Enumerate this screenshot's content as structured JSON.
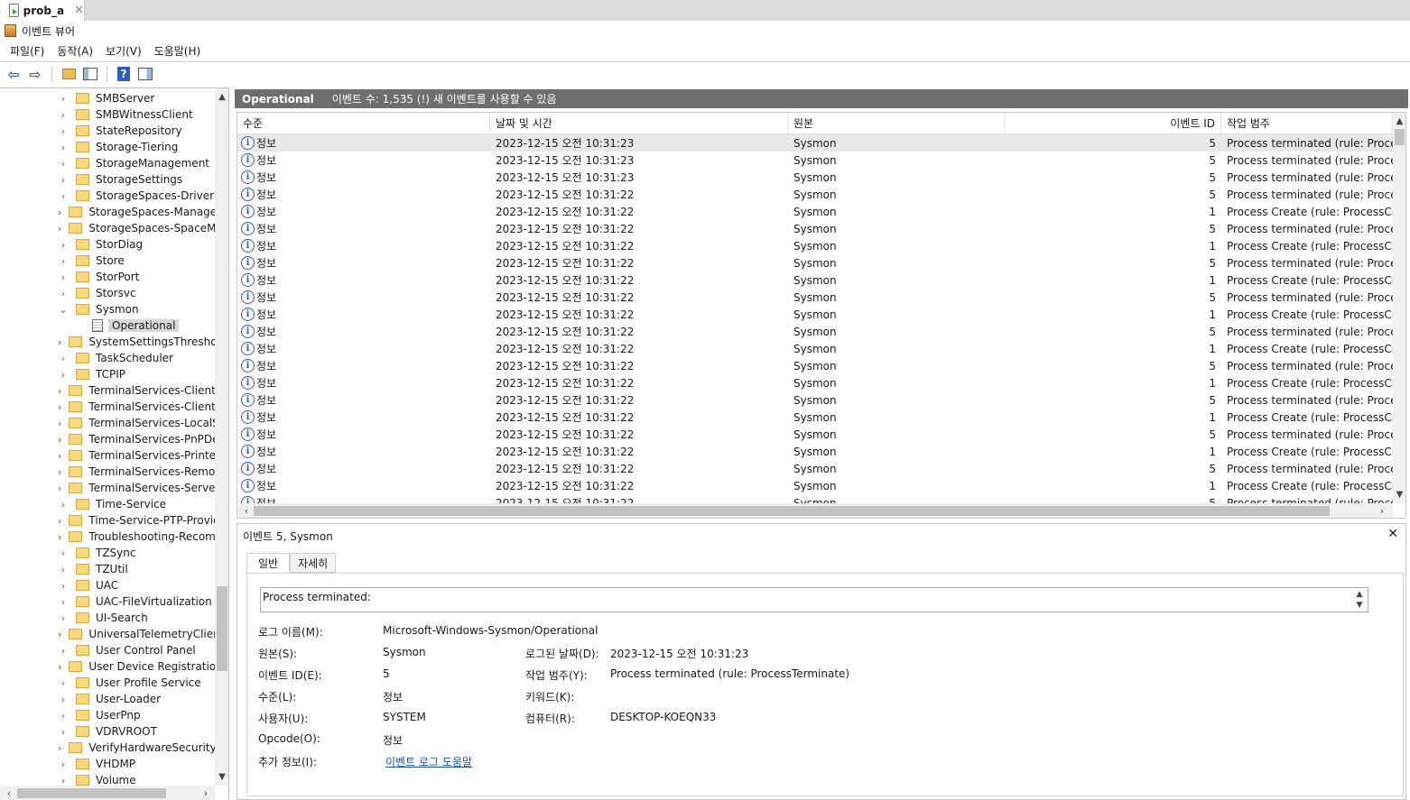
{
  "tab": {
    "title": "prob_a",
    "close": "✕"
  },
  "app": {
    "title": "이벤트 뷰어"
  },
  "menu": [
    "파일(F)",
    "동작(A)",
    "보기(V)",
    "도움말(H)"
  ],
  "tree": {
    "items": [
      {
        "label": "SMBServer",
        "expanded": false
      },
      {
        "label": "SMBWitnessClient",
        "expanded": false
      },
      {
        "label": "StateRepository",
        "expanded": false
      },
      {
        "label": "Storage-Tiering",
        "expanded": false
      },
      {
        "label": "StorageManagement",
        "expanded": false
      },
      {
        "label": "StorageSettings",
        "expanded": false
      },
      {
        "label": "StorageSpaces-Driver",
        "expanded": false
      },
      {
        "label": "StorageSpaces-Managem",
        "expanded": false
      },
      {
        "label": "StorageSpaces-SpaceMai",
        "expanded": false
      },
      {
        "label": "StorDiag",
        "expanded": false
      },
      {
        "label": "Store",
        "expanded": false
      },
      {
        "label": "StorPort",
        "expanded": false
      },
      {
        "label": "Storsvc",
        "expanded": false
      },
      {
        "label": "Sysmon",
        "expanded": true
      },
      {
        "label": "Operational",
        "log": true,
        "selected": true
      },
      {
        "label": "SystemSettingsThreshold",
        "expanded": false
      },
      {
        "label": "TaskScheduler",
        "expanded": false
      },
      {
        "label": "TCPIP",
        "expanded": false
      },
      {
        "label": "TerminalServices-ClientA",
        "expanded": false
      },
      {
        "label": "TerminalServices-ClientU",
        "expanded": false
      },
      {
        "label": "TerminalServices-LocalSe",
        "expanded": false
      },
      {
        "label": "TerminalServices-PnPDev",
        "expanded": false
      },
      {
        "label": "TerminalServices-Printers",
        "expanded": false
      },
      {
        "label": "TerminalServices-Remote",
        "expanded": false
      },
      {
        "label": "TerminalServices-ServerU",
        "expanded": false
      },
      {
        "label": "Time-Service",
        "expanded": false
      },
      {
        "label": "Time-Service-PTP-Provid",
        "expanded": false
      },
      {
        "label": "Troubleshooting-Recomm",
        "expanded": false
      },
      {
        "label": "TZSync",
        "expanded": false
      },
      {
        "label": "TZUtil",
        "expanded": false
      },
      {
        "label": "UAC",
        "expanded": false
      },
      {
        "label": "UAC-FileVirtualization",
        "expanded": false
      },
      {
        "label": "UI-Search",
        "expanded": false
      },
      {
        "label": "UniversalTelemetryClient",
        "expanded": false
      },
      {
        "label": "User Control Panel",
        "expanded": false
      },
      {
        "label": "User Device Registration",
        "expanded": false
      },
      {
        "label": "User Profile Service",
        "expanded": false
      },
      {
        "label": "User-Loader",
        "expanded": false
      },
      {
        "label": "UserPnp",
        "expanded": false
      },
      {
        "label": "VDRVROOT",
        "expanded": false
      },
      {
        "label": "VerifyHardwareSecurity",
        "expanded": false
      },
      {
        "label": "VHDMP",
        "expanded": false
      },
      {
        "label": "Volume",
        "expanded": false
      }
    ]
  },
  "header": {
    "title": "Operational",
    "count": "이벤트 수: 1,535 (!) 새 이벤트를 사용할 수 있음"
  },
  "columns": [
    "수준",
    "날짜 및 시간",
    "원본",
    "이벤트 ID",
    "작업 범주"
  ],
  "events": [
    {
      "level": "정보",
      "date": "2023-12-15 오전 10:31:23",
      "source": "Sysmon",
      "id": "5",
      "category": "Process terminated (rule: ProcessT"
    },
    {
      "level": "정보",
      "date": "2023-12-15 오전 10:31:23",
      "source": "Sysmon",
      "id": "5",
      "category": "Process terminated (rule: ProcessT"
    },
    {
      "level": "정보",
      "date": "2023-12-15 오전 10:31:23",
      "source": "Sysmon",
      "id": "5",
      "category": "Process terminated (rule: ProcessT"
    },
    {
      "level": "정보",
      "date": "2023-12-15 오전 10:31:22",
      "source": "Sysmon",
      "id": "5",
      "category": "Process terminated (rule: ProcessT"
    },
    {
      "level": "정보",
      "date": "2023-12-15 오전 10:31:22",
      "source": "Sysmon",
      "id": "1",
      "category": "Process Create (rule: ProcessCreat"
    },
    {
      "level": "정보",
      "date": "2023-12-15 오전 10:31:22",
      "source": "Sysmon",
      "id": "5",
      "category": "Process terminated (rule: ProcessT"
    },
    {
      "level": "정보",
      "date": "2023-12-15 오전 10:31:22",
      "source": "Sysmon",
      "id": "1",
      "category": "Process Create (rule: ProcessCreat"
    },
    {
      "level": "정보",
      "date": "2023-12-15 오전 10:31:22",
      "source": "Sysmon",
      "id": "5",
      "category": "Process terminated (rule: ProcessT"
    },
    {
      "level": "정보",
      "date": "2023-12-15 오전 10:31:22",
      "source": "Sysmon",
      "id": "1",
      "category": "Process Create (rule: ProcessCreat"
    },
    {
      "level": "정보",
      "date": "2023-12-15 오전 10:31:22",
      "source": "Sysmon",
      "id": "5",
      "category": "Process terminated (rule: ProcessT"
    },
    {
      "level": "정보",
      "date": "2023-12-15 오전 10:31:22",
      "source": "Sysmon",
      "id": "1",
      "category": "Process Create (rule: ProcessCreat"
    },
    {
      "level": "정보",
      "date": "2023-12-15 오전 10:31:22",
      "source": "Sysmon",
      "id": "5",
      "category": "Process terminated (rule: ProcessT"
    },
    {
      "level": "정보",
      "date": "2023-12-15 오전 10:31:22",
      "source": "Sysmon",
      "id": "1",
      "category": "Process Create (rule: ProcessCreat"
    },
    {
      "level": "정보",
      "date": "2023-12-15 오전 10:31:22",
      "source": "Sysmon",
      "id": "5",
      "category": "Process terminated (rule: ProcessT"
    },
    {
      "level": "정보",
      "date": "2023-12-15 오전 10:31:22",
      "source": "Sysmon",
      "id": "1",
      "category": "Process Create (rule: ProcessCreat"
    },
    {
      "level": "정보",
      "date": "2023-12-15 오전 10:31:22",
      "source": "Sysmon",
      "id": "5",
      "category": "Process terminated (rule: ProcessT"
    },
    {
      "level": "정보",
      "date": "2023-12-15 오전 10:31:22",
      "source": "Sysmon",
      "id": "1",
      "category": "Process Create (rule: ProcessCreat"
    },
    {
      "level": "정보",
      "date": "2023-12-15 오전 10:31:22",
      "source": "Sysmon",
      "id": "5",
      "category": "Process terminated (rule: ProcessT"
    },
    {
      "level": "정보",
      "date": "2023-12-15 오전 10:31:22",
      "source": "Sysmon",
      "id": "1",
      "category": "Process Create (rule: ProcessCreat"
    },
    {
      "level": "정보",
      "date": "2023-12-15 오전 10:31:22",
      "source": "Sysmon",
      "id": "5",
      "category": "Process terminated (rule: ProcessT"
    },
    {
      "level": "정보",
      "date": "2023-12-15 오전 10:31:22",
      "source": "Sysmon",
      "id": "1",
      "category": "Process Create (rule: ProcessCreat"
    },
    {
      "level": "정보",
      "date": "2023-12-15 오전 10:31:22",
      "source": "Sysmon",
      "id": "5",
      "category": "Process terminated (rule: ProcessT"
    }
  ],
  "detail": {
    "title": "이벤트 5, Sysmon",
    "tabs": [
      "일반",
      "자세히"
    ],
    "description": "Process terminated:",
    "labels": {
      "log_name": "로그 이름(M):",
      "source": "원본(S):",
      "event_id": "이벤트 ID(E):",
      "level": "수준(L):",
      "user": "사용자(U):",
      "opcode": "Opcode(O):",
      "more_info": "추가 정보(I):",
      "logged": "로그된 날짜(D):",
      "task_category": "작업 범주(Y):",
      "keywords": "키워드(K):",
      "computer": "컴퓨터(R):"
    },
    "values": {
      "log_name": "Microsoft-Windows-Sysmon/Operational",
      "source": "Sysmon",
      "event_id": "5",
      "level": "정보",
      "user": "SYSTEM",
      "opcode": "정보",
      "more_info": "이벤트 로그 도움말",
      "logged": "2023-12-15 오전 10:31:23",
      "task_category": "Process terminated (rule: ProcessTerminate)",
      "keywords": "",
      "computer": "DESKTOP-KOEQN33"
    }
  }
}
